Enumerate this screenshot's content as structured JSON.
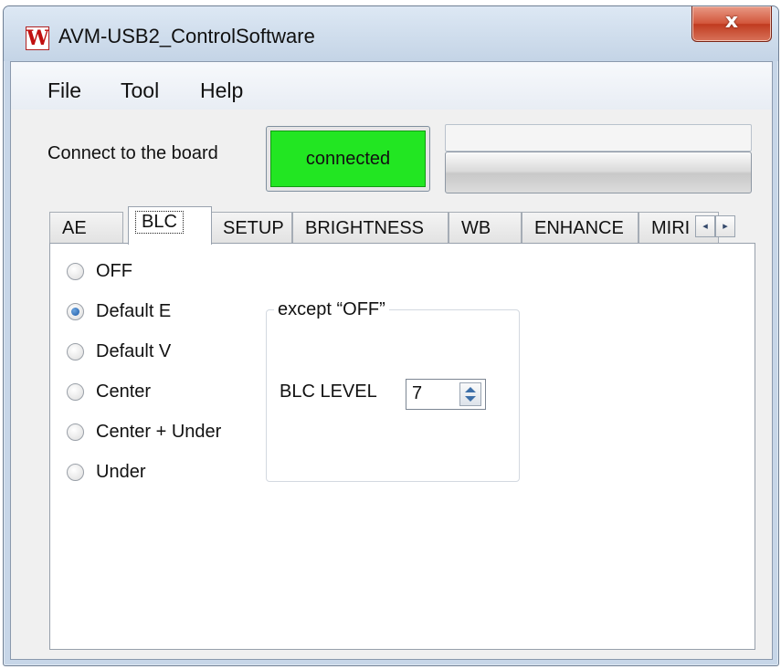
{
  "window": {
    "title": "AVM-USB2_ControlSoftware",
    "icon_letter": "W",
    "close_glyph": "x"
  },
  "menu": {
    "items": [
      "File",
      "Tool",
      "Help"
    ]
  },
  "connection": {
    "label": "Connect to the board",
    "status": "connected",
    "status_color": "#22e622"
  },
  "tabs": {
    "items": [
      "AE",
      "BLC",
      "SETUP",
      "BRIGHTNESS",
      "WB",
      "ENHANCE",
      "MIRI"
    ],
    "active": "BLC",
    "scroll_left": "◂",
    "scroll_right": "▸"
  },
  "blc": {
    "modes": [
      "OFF",
      "Default E",
      "Default V",
      "Center",
      "Center + Under",
      "Under"
    ],
    "selected": "Default E",
    "group_title": "except “OFF”",
    "level_label": "BLC LEVEL",
    "level_value": "7"
  }
}
